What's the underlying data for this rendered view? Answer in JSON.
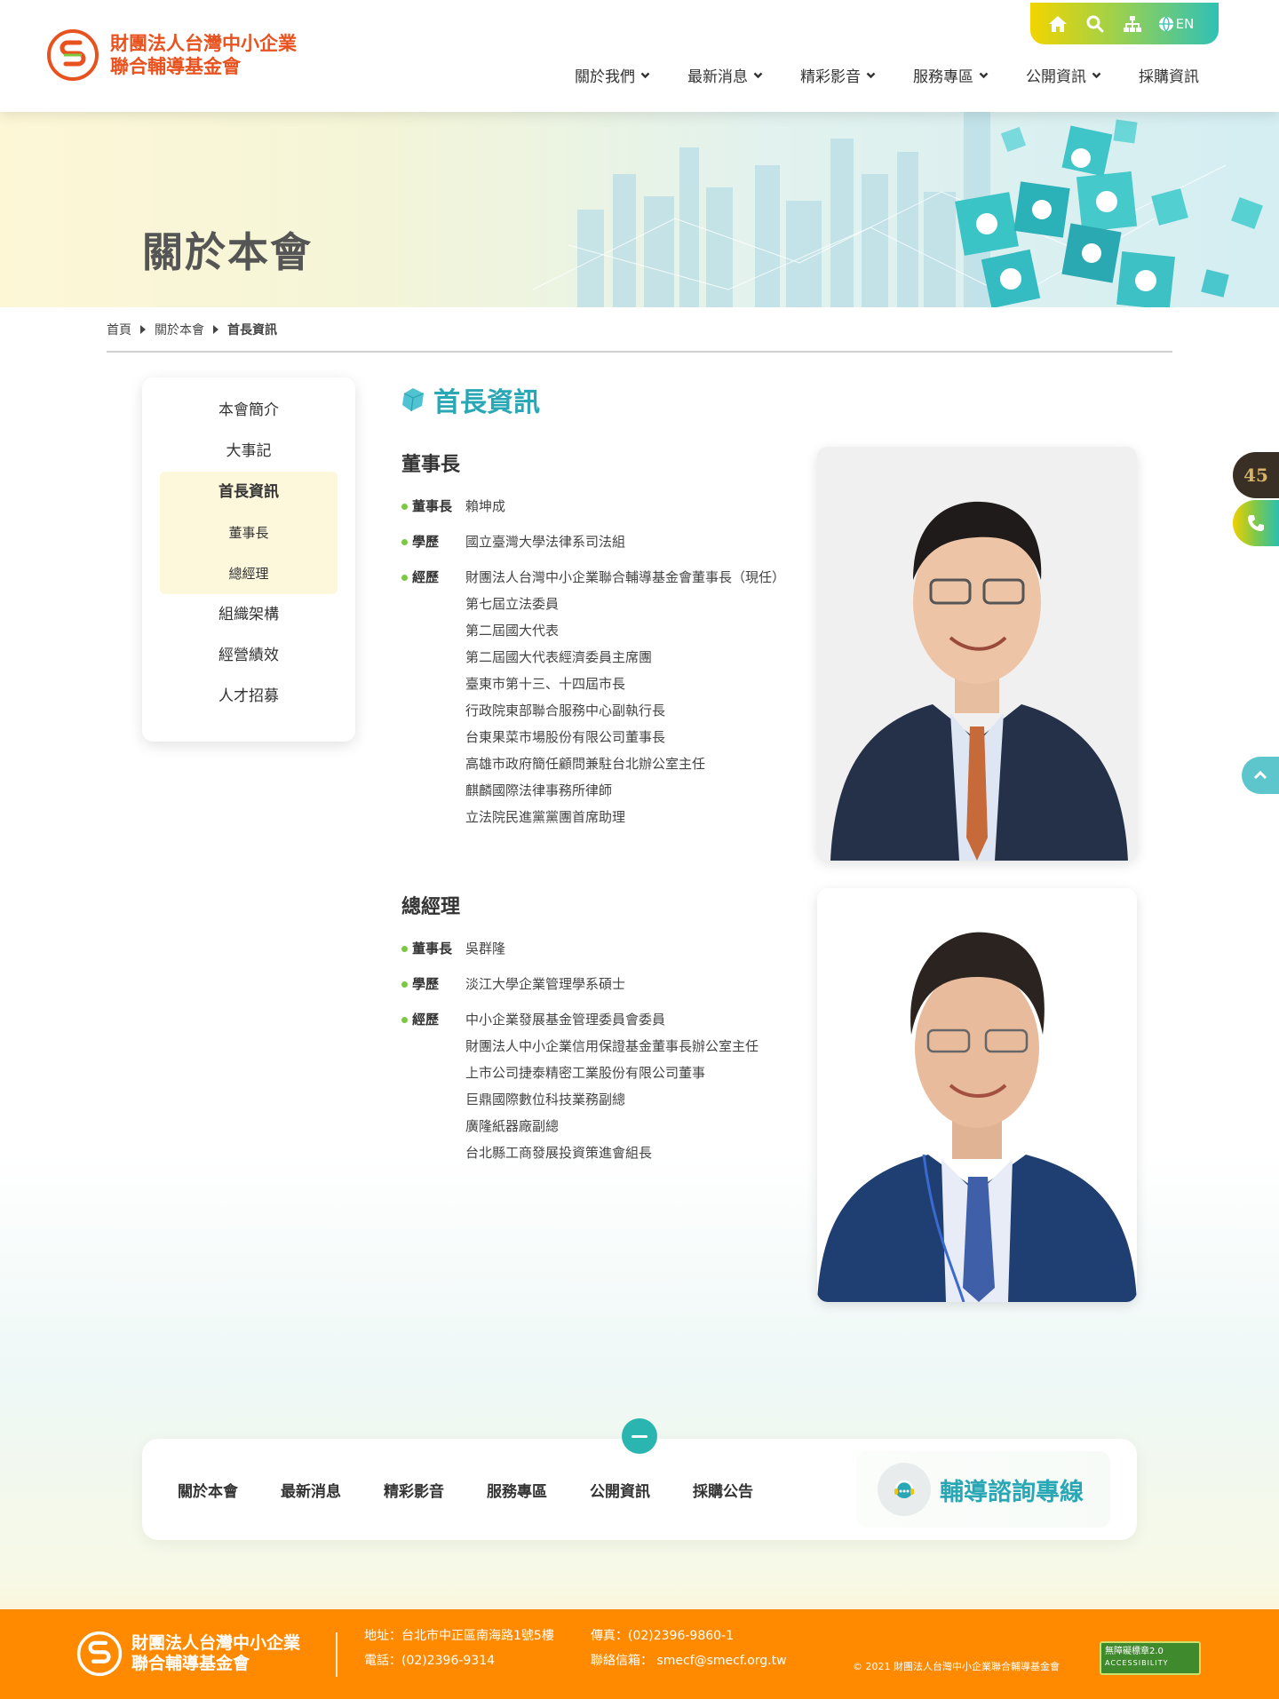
{
  "header": {
    "logo_line1": "財團法人台灣中小企業",
    "logo_line2": "聯合輔導基金會",
    "lang_label": "EN",
    "nav": [
      "關於我們",
      "最新消息",
      "精彩影音",
      "服務專區",
      "公開資訊",
      "採購資訊"
    ]
  },
  "banner": {
    "title": "關於本會"
  },
  "breadcrumb": [
    "首頁",
    "關於本會",
    "首長資訊"
  ],
  "sidebar": {
    "items": [
      "本會簡介",
      "大事記",
      "首長資訊",
      "董事長",
      "總經理",
      "組織架構",
      "經營績效",
      "人才招募"
    ]
  },
  "main": {
    "title": "首長資訊",
    "chairman": {
      "heading": "董事長",
      "name_label": "董事長",
      "name": "賴坤成",
      "edu_label": "學歷",
      "edu": "國立臺灣大學法律系司法組",
      "exp_label": "經歷",
      "exp": [
        "財團法人台灣中小企業聯合輔導基金會董事長（現任）",
        "第七屆立法委員",
        "第二屆國大代表",
        "第二屆國大代表經濟委員主席團",
        "臺東市第十三、十四屆市長",
        "行政院東部聯合服務中心副執行長",
        "台東果菜市場股份有限公司董事長",
        "高雄市政府簡任顧問兼駐台北辦公室主任",
        "麒麟國際法律事務所律師",
        "立法院民進黨黨團首席助理"
      ]
    },
    "gm": {
      "heading": "總經理",
      "name_label": "董事長",
      "name": "吳群隆",
      "edu_label": "學歷",
      "edu": "淡江大學企業管理學系碩士",
      "exp_label": "經歷",
      "exp": [
        "中小企業發展基金管理委員會委員",
        "財團法人中小企業信用保證基金董事長辦公室主任",
        "上市公司捷泰精密工業股份有限公司董事",
        "巨鼎國際數位科技業務副總",
        "廣隆紙器廠副總",
        "台北縣工商發展投資策進會組長"
      ]
    }
  },
  "floating": {
    "badge_text": "45"
  },
  "footer_nav": {
    "links": [
      "關於本會",
      "最新消息",
      "精彩影音",
      "服務專區",
      "公開資訊",
      "採購公告"
    ],
    "hotline": "輔導諮詢專線"
  },
  "footer": {
    "logo_line1": "財團法人台灣中小企業",
    "logo_line2": "聯合輔導基金會",
    "address": "地址：台北市中正區南海路1號5樓",
    "phone": "電話：(02)2396-9314",
    "fax": "傳真：(02)2396-9860-1",
    "email": "聯絡信箱： smecf@smecf.org.tw",
    "copyright": "© 2021 財團法人台灣中小企業聯合輔導基金會",
    "accessibility_line1": "無障礙標章2.0",
    "accessibility_line2": "ACCESSIBILITY"
  },
  "colors": {
    "brand_orange": "#ff8a00",
    "accent_teal": "#2aa7b5",
    "logo_red": "#e8521f",
    "bullet_green": "#7bc843"
  }
}
